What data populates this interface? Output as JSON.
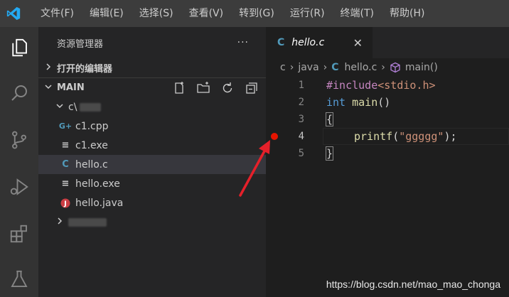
{
  "menu": [
    "文件(F)",
    "编辑(E)",
    "选择(S)",
    "查看(V)",
    "转到(G)",
    "运行(R)",
    "终端(T)",
    "帮助(H)"
  ],
  "activity_bar": [
    "explorer-icon",
    "search-icon",
    "source-control-icon",
    "run-debug-icon",
    "extensions-icon",
    "testing-icon"
  ],
  "sidebar": {
    "title": "资源管理器",
    "more": "···",
    "open_editors": "打开的编辑器",
    "workspace": "MAIN",
    "folder": "c\\",
    "files": [
      {
        "name": "c1.cpp",
        "icon": "C++",
        "color": "#519aba"
      },
      {
        "name": "c1.exe",
        "icon": "≡",
        "color": "#cccccc"
      },
      {
        "name": "hello.c",
        "icon": "C",
        "color": "#519aba"
      },
      {
        "name": "hello.exe",
        "icon": "≡",
        "color": "#cccccc"
      },
      {
        "name": "hello.java",
        "icon": "J",
        "color": "#cc3e44"
      }
    ]
  },
  "editor": {
    "tab": {
      "icon": "C",
      "label": "hello.c",
      "close": "✕"
    },
    "breadcrumb": {
      "seg1": "c",
      "seg2": "java",
      "seg3": "hello.c",
      "seg4": "main()"
    },
    "lines": [
      "1",
      "2",
      "3",
      "4",
      "5"
    ],
    "code": {
      "l1_pp": "#include",
      "l1_inc": "<stdio.h>",
      "l2_kw": "int",
      "l2_fn": "main",
      "l2_p": "()",
      "l3": "{",
      "l4_fn": "printf",
      "l4_p1": "(",
      "l4_str": "\"ggggg\"",
      "l4_p2": ");",
      "l5": "}"
    }
  },
  "watermark": "https://blog.csdn.net/mao_mao_chonga"
}
